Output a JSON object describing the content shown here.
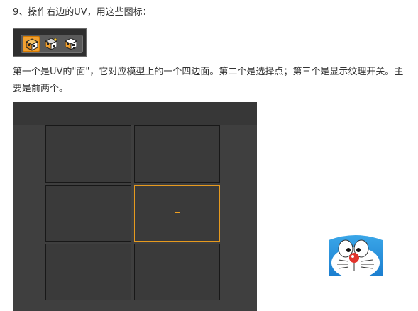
{
  "heading": "9、操作右边的UV，用这些图标：",
  "toolbar": {
    "icons": [
      {
        "name": "uv-face-mode-icon",
        "active": true
      },
      {
        "name": "uv-point-mode-icon",
        "active": false
      },
      {
        "name": "show-texture-toggle-icon",
        "active": false
      }
    ]
  },
  "description": "第一个是UV的\"面\"，它对应模型上的一个四边面。第二个是选择点；第三个是显示纹理开关。主要是前两个。",
  "uv_editor": {
    "grid_rows": 3,
    "grid_cols": 2,
    "selected_face": {
      "row": 1,
      "col": 1
    },
    "background_color": "#3f3f3f",
    "selection_color": "#e69a1e"
  }
}
